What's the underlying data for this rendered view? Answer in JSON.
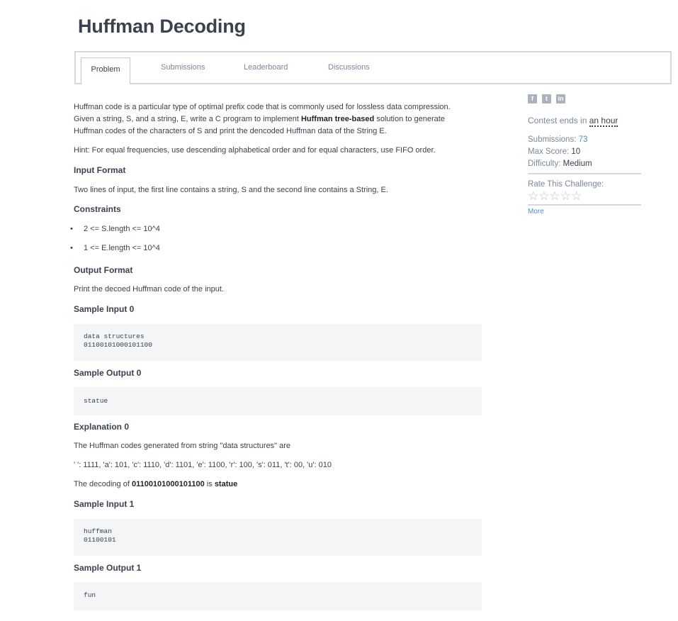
{
  "page": {
    "title": "Huffman Decoding"
  },
  "tabs": [
    {
      "label": "Problem"
    },
    {
      "label": "Submissions"
    },
    {
      "label": "Leaderboard"
    },
    {
      "label": "Discussions"
    }
  ],
  "problem": {
    "intro_1": "Huffman code is a particular type of optimal prefix code that is commonly used for lossless data compression.",
    "intro_2a": "Given a string, S, and a string, E, write a C program to implement ",
    "intro_2_bold": "Huffman tree-based",
    "intro_2b": " solution to generate",
    "intro_3": "Huffman codes of the characters of S and print the dencoded Huffman data of the String E.",
    "hint": "Hint: For equal frequencies, use descending alphabetical order and for equal characters, use FIFO order.",
    "input_format_heading": "Input Format",
    "input_format": "Two lines of input, the first line contains a string, S and the second line contains a String, E.",
    "constraints_heading": "Constraints",
    "constraints": [
      "2 <= S.length <= 10^4",
      "1 <= E.length <= 10^4"
    ],
    "output_format_heading": "Output Format",
    "output_format": "Print the decoed Huffman code of the input.",
    "sample_input_0_heading": "Sample Input 0",
    "sample_input_0": [
      "data structures",
      "01100101000101100"
    ],
    "sample_output_0_heading": "Sample Output 0",
    "sample_output_0": "statue",
    "explanation_0_heading": "Explanation 0",
    "explanation_0_line1": "The Huffman codes generated from string \"data structures\" are",
    "explanation_0_line2": "' ': 1111, 'a': 101, 'c': 1110, 'd': 1101, 'e': 1100, 'r': 100, 's': 011, 't': 00, 'u': 010",
    "explanation_0_line3a": "The decoding of ",
    "explanation_0_line3_code": "01100101000101100",
    "explanation_0_line3b": " is ",
    "explanation_0_line3_result": "statue",
    "sample_input_1_heading": "Sample Input 1",
    "sample_input_1": [
      "huffman",
      "01100101"
    ],
    "sample_output_1_heading": "Sample Output 1",
    "sample_output_1": "fun"
  },
  "sidebar": {
    "share_icons": [
      "facebook-icon",
      "twitter-icon",
      "linkedin-icon"
    ],
    "share_glyphs": {
      "facebook": "f",
      "twitter": "t",
      "linkedin": "in"
    },
    "contest_prefix": "Contest ends in ",
    "contest_time": "an hour",
    "submissions_label": "Submissions: ",
    "submissions_value": "73",
    "max_score_label": "Max Score: ",
    "max_score_value": "10",
    "difficulty_label": "Difficulty: ",
    "difficulty_value": "Medium",
    "rate_title": "Rate This Challenge:",
    "stars": "☆☆☆☆☆",
    "more_label": "More"
  }
}
